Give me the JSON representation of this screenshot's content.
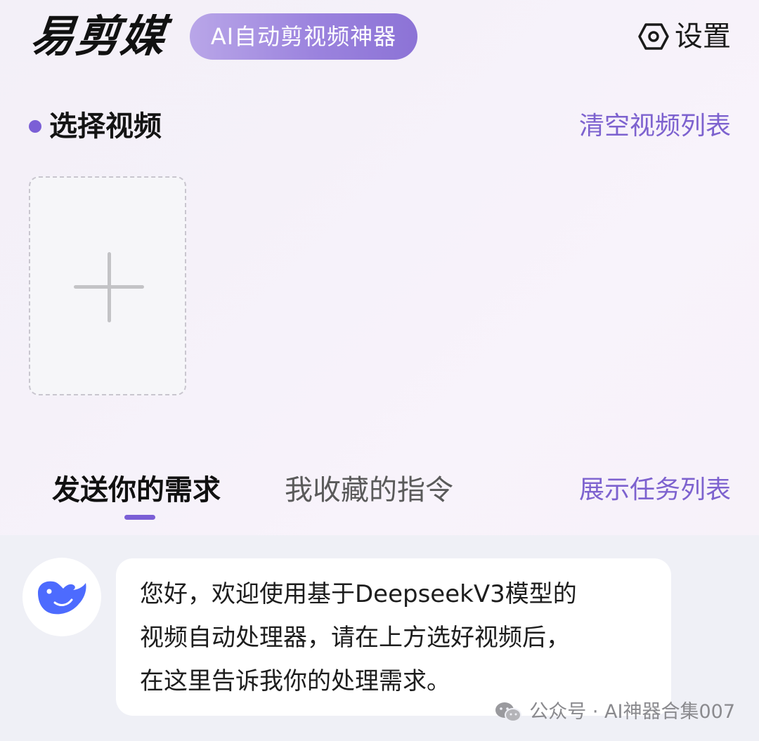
{
  "header": {
    "logo": "易剪媒",
    "tagline": "AI自动剪视频神器",
    "settings_icon": "settings-hexagon-icon",
    "settings_label": "设置"
  },
  "video_section": {
    "title": "选择视频",
    "clear_link": "清空视频列表",
    "upload_icon": "plus-icon"
  },
  "tabs": {
    "items": [
      {
        "label": "发送你的需求",
        "active": true
      },
      {
        "label": "我收藏的指令",
        "active": false
      }
    ],
    "task_link": "展示任务列表"
  },
  "chat": {
    "avatar_icon": "deepseek-whale-icon",
    "message_lines": [
      "您好，欢迎使用基于DeepseekV3模型的",
      "视频自动处理器，请在上方选好视频后，",
      "在这里告诉我你的处理需求。"
    ]
  },
  "watermark": {
    "icon": "wechat-icon",
    "text": "公众号 · AI神器合集007"
  },
  "colors": {
    "accent": "#7b5fd6",
    "link": "#7d62cf",
    "pill_start": "#b9a6e8",
    "pill_end": "#8c73d6",
    "avatar_blue": "#4d6bfe"
  }
}
